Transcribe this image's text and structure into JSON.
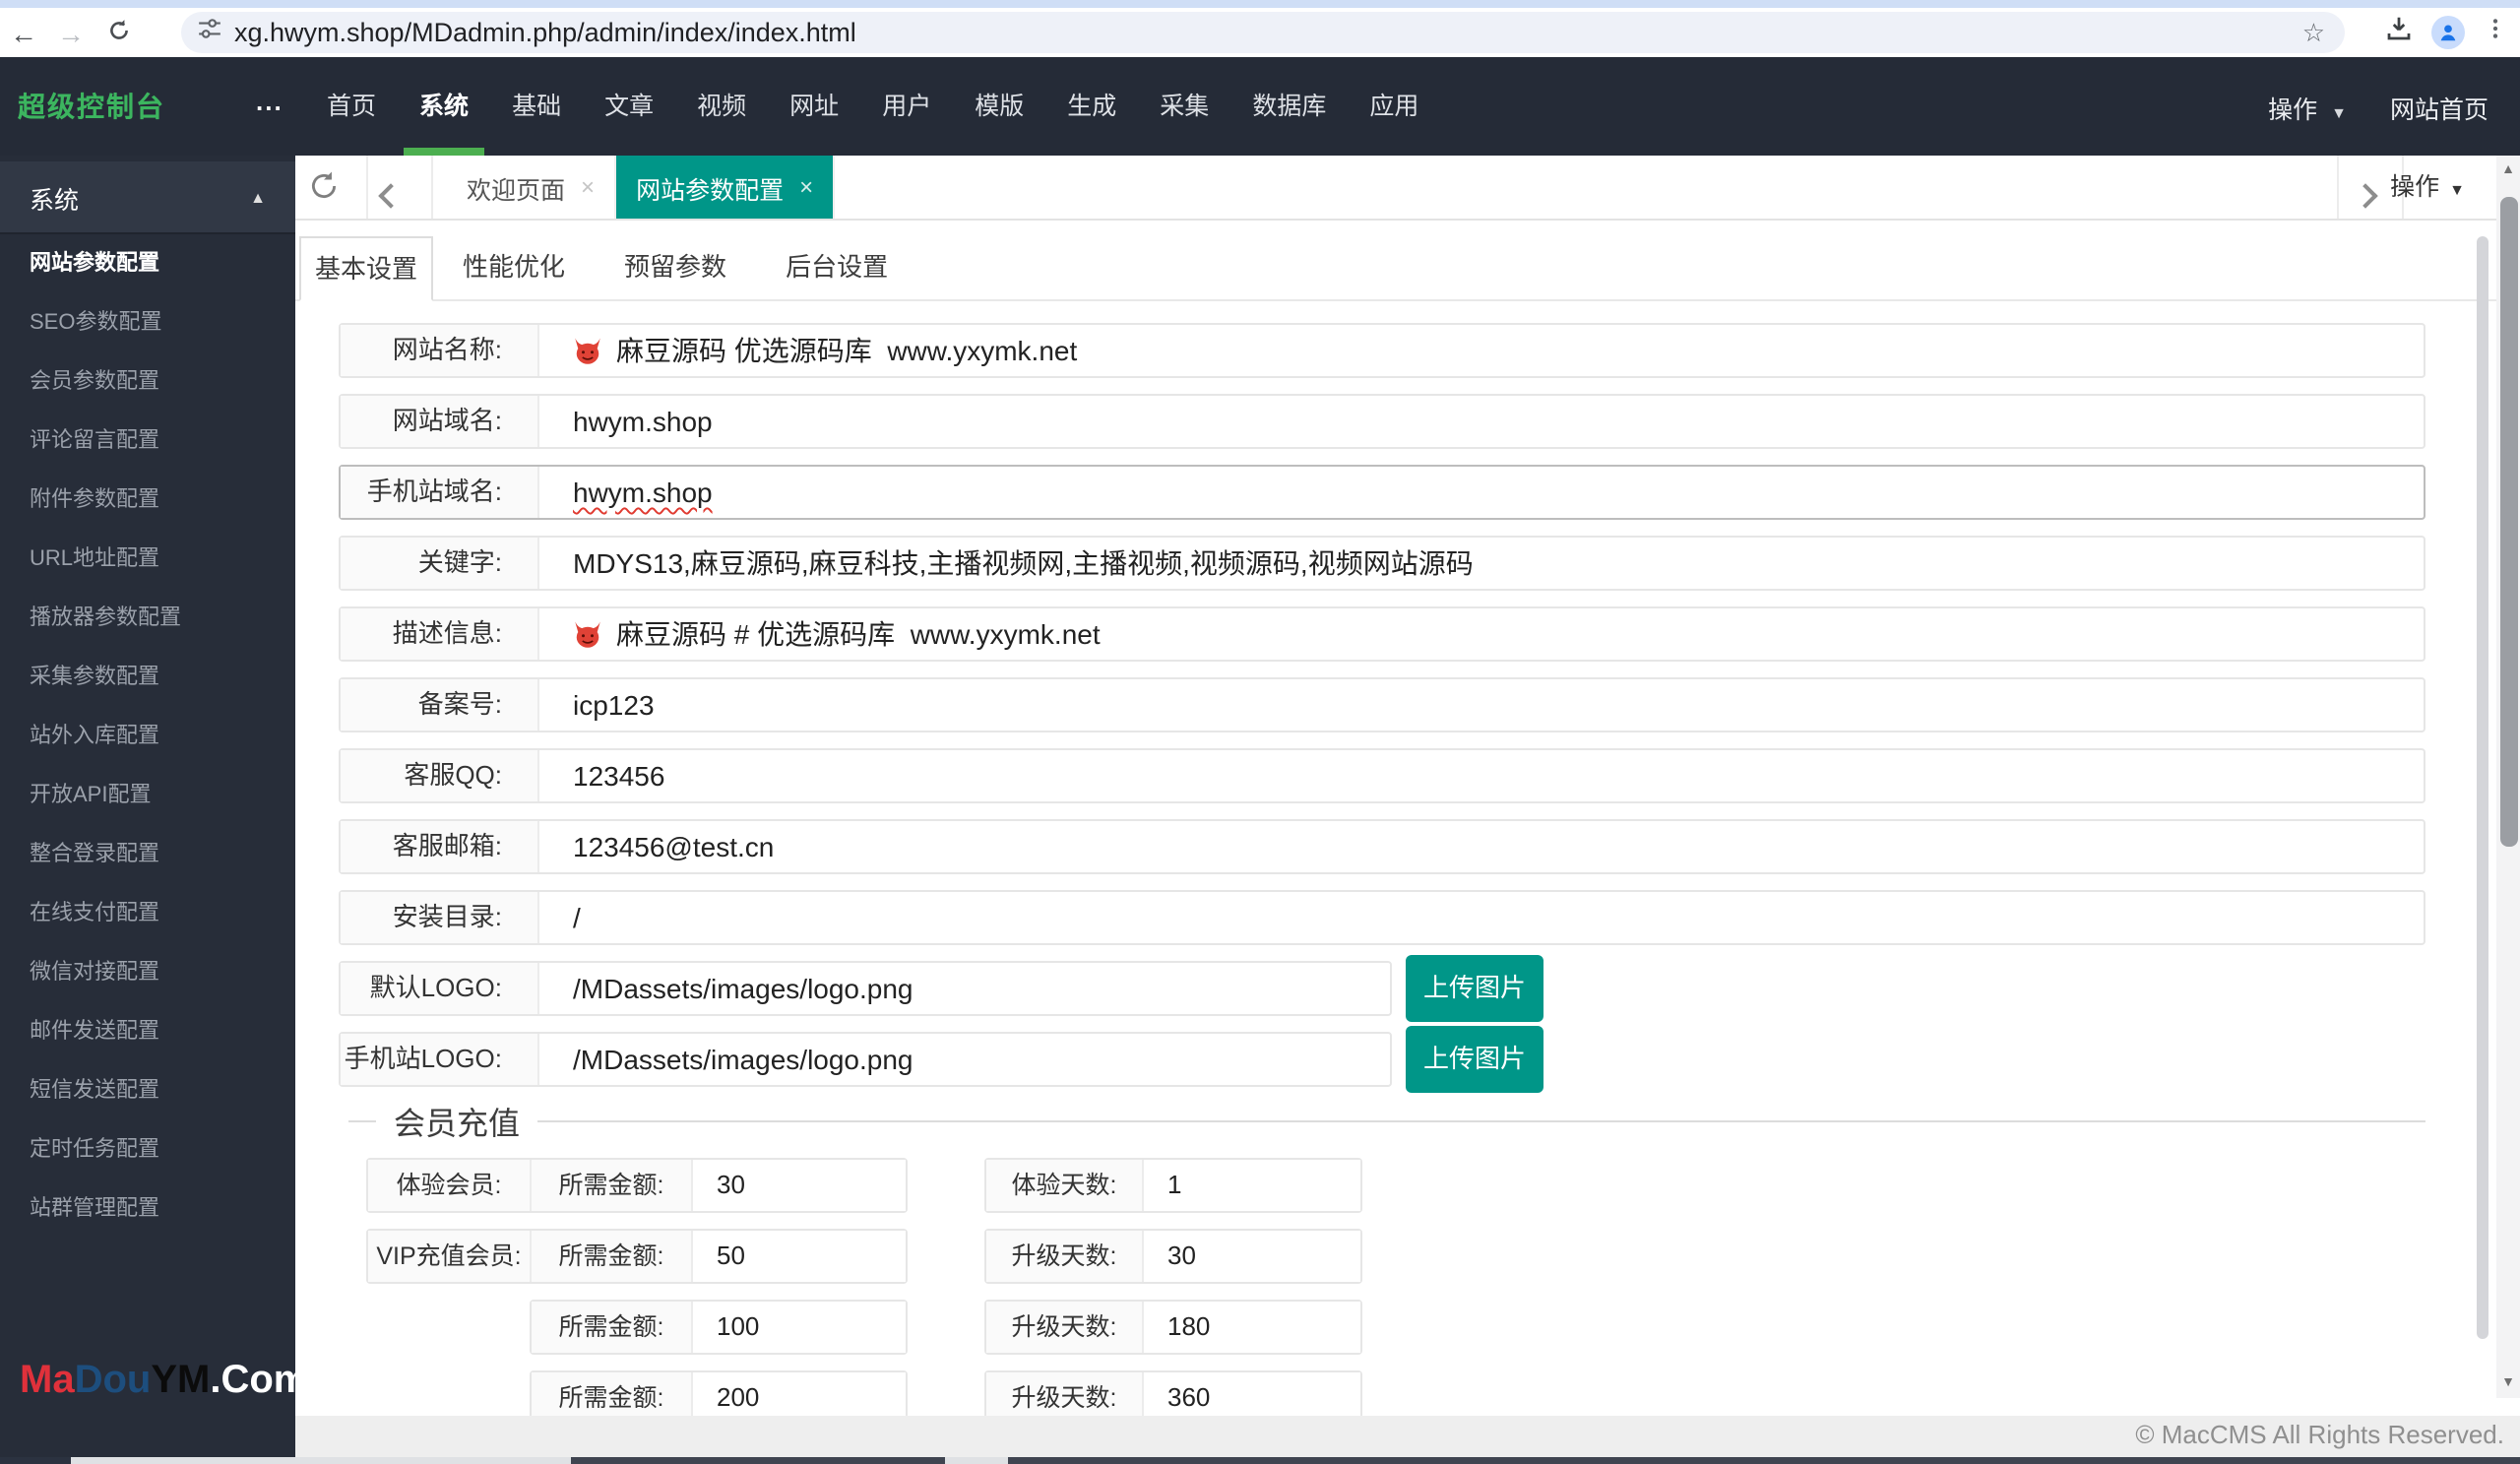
{
  "browser": {
    "url": "xg.hwym.shop/MDadmin.php/admin/index/index.html"
  },
  "header": {
    "logo": "超级控制台",
    "ellipsis": "...",
    "nav": [
      {
        "label": "首页",
        "active": false
      },
      {
        "label": "系统",
        "active": true
      },
      {
        "label": "基础",
        "active": false
      },
      {
        "label": "文章",
        "active": false
      },
      {
        "label": "视频",
        "active": false
      },
      {
        "label": "网址",
        "active": false
      },
      {
        "label": "用户",
        "active": false
      },
      {
        "label": "模版",
        "active": false
      },
      {
        "label": "生成",
        "active": false
      },
      {
        "label": "采集",
        "active": false
      },
      {
        "label": "数据库",
        "active": false
      },
      {
        "label": "应用",
        "active": false
      }
    ],
    "action_label": "操作",
    "home_label": "网站首页"
  },
  "sidebar": {
    "section": "系统",
    "collapse_glyph": "▲",
    "items": [
      {
        "label": "网站参数配置",
        "active": true
      },
      {
        "label": "SEO参数配置",
        "active": false
      },
      {
        "label": "会员参数配置",
        "active": false
      },
      {
        "label": "评论留言配置",
        "active": false
      },
      {
        "label": "附件参数配置",
        "active": false
      },
      {
        "label": "URL地址配置",
        "active": false
      },
      {
        "label": "播放器参数配置",
        "active": false
      },
      {
        "label": "采集参数配置",
        "active": false
      },
      {
        "label": "站外入库配置",
        "active": false
      },
      {
        "label": "开放API配置",
        "active": false
      },
      {
        "label": "整合登录配置",
        "active": false
      },
      {
        "label": "在线支付配置",
        "active": false
      },
      {
        "label": "微信对接配置",
        "active": false
      },
      {
        "label": "邮件发送配置",
        "active": false
      },
      {
        "label": "短信发送配置",
        "active": false
      },
      {
        "label": "定时任务配置",
        "active": false
      },
      {
        "label": "站群管理配置",
        "active": false
      }
    ],
    "brand": {
      "parts": [
        {
          "text": "Ma",
          "color": "#e0313b"
        },
        {
          "text": "Dou",
          "color": "#1d4e7e"
        },
        {
          "text": "YM",
          "color": "#0b0b0b"
        },
        {
          "text": ".Com",
          "color": "#ffffff"
        }
      ]
    }
  },
  "tabbar": {
    "tabs": [
      {
        "label": "欢迎页面",
        "active": false
      },
      {
        "label": "网站参数配置",
        "active": true
      }
    ],
    "close_glyph": "×",
    "action_label": "操作"
  },
  "subtabs": [
    {
      "label": "基本设置",
      "active": true
    },
    {
      "label": "性能优化",
      "active": false
    },
    {
      "label": "预留参数",
      "active": false
    },
    {
      "label": "后台设置",
      "active": false
    }
  ],
  "form": {
    "upload_label": "上传图片",
    "rows": [
      {
        "label": "网站名称:",
        "value": "麻豆源码 优选源码库  www.yxymk.net",
        "devil": true
      },
      {
        "label": "网站域名:",
        "value": "hwym.shop"
      },
      {
        "label": "手机站域名:",
        "value": "hwym.shop",
        "spellcheck": true,
        "focused": true
      },
      {
        "label": "关键字:",
        "value": "MDYS13,麻豆源码,麻豆科技,主播视频网,主播视频,视频源码,视频网站源码"
      },
      {
        "label": "描述信息:",
        "value": "麻豆源码 # 优选源码库  www.yxymk.net",
        "devil": true
      },
      {
        "label": "备案号:",
        "value": "icp123"
      },
      {
        "label": "客服QQ:",
        "value": "123456"
      },
      {
        "label": "客服邮箱:",
        "value": "123456@test.cn"
      },
      {
        "label": "安装目录:",
        "value": "/"
      },
      {
        "label": "默认LOGO:",
        "value": "/MDassets/images/logo.png",
        "upload": true
      },
      {
        "label": "手机站LOGO:",
        "value": "/MDassets/images/logo.png",
        "upload": true
      }
    ]
  },
  "member": {
    "legend": "会员充值",
    "rows": [
      {
        "tier": "体验会员:",
        "amount_label": "所需金额:",
        "amount": "30",
        "days_label": "体验天数:",
        "days": "1"
      },
      {
        "tier": "VIP充值会员:",
        "amount_label": "所需金额:",
        "amount": "50",
        "days_label": "升级天数:",
        "days": "30"
      },
      {
        "tier": "",
        "amount_label": "所需金额:",
        "amount": "100",
        "days_label": "升级天数:",
        "days": "180"
      },
      {
        "tier": "",
        "amount_label": "所需金额:",
        "amount": "200",
        "days_label": "升级天数:",
        "days": "360"
      }
    ]
  },
  "footer": {
    "copyright": "© MacCMS All Rights Reserved."
  },
  "colors": {
    "accent_teal": "#009688",
    "accent_green": "#4caf50",
    "header_bg": "#252b37",
    "sidebar_bg": "#272d39",
    "logo_green": "#3cb55f",
    "devil_red": "#e04236"
  }
}
